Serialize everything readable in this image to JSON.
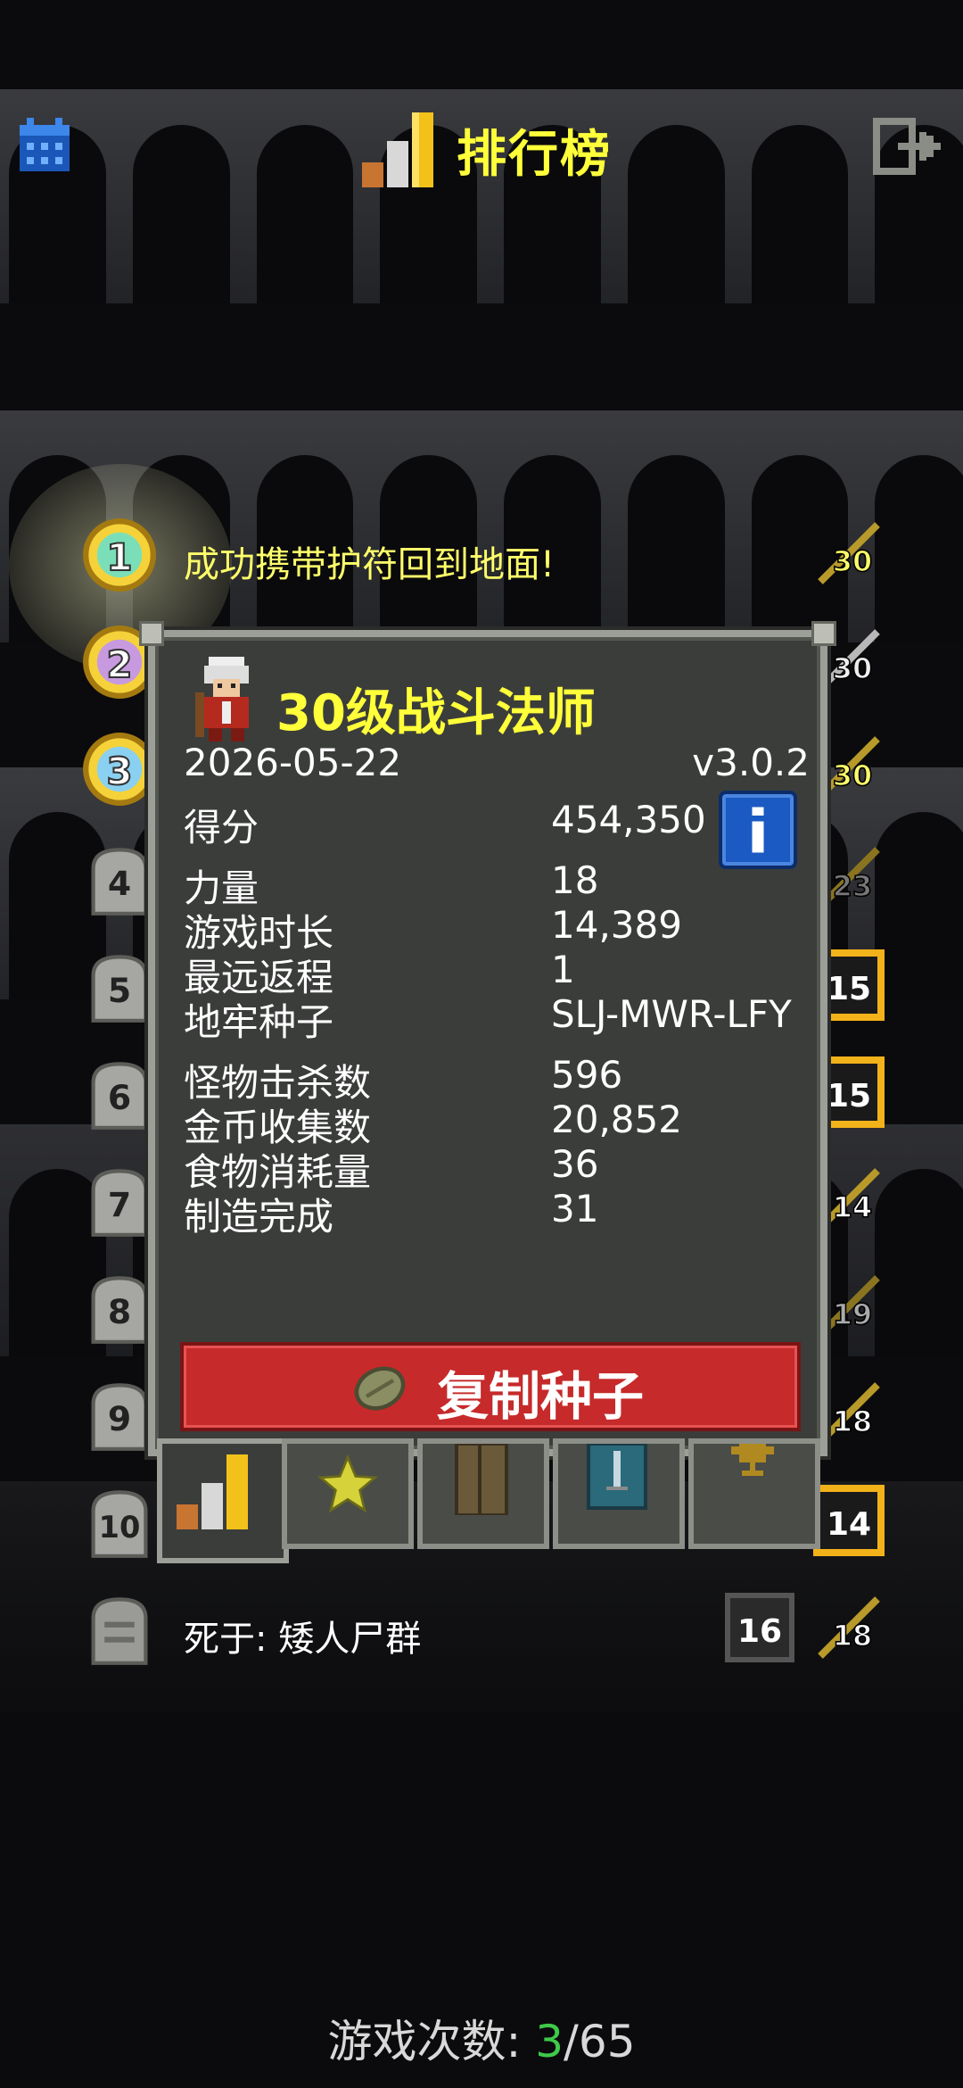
{
  "header": {
    "title": "排行榜",
    "calendar_icon": "calendar-icon",
    "exit_icon": "exit-icon",
    "title_icon": "bar-chart-icon"
  },
  "rows": [
    {
      "rank": "1",
      "text": "成功携带护符回到地面!",
      "level": "30",
      "badge": "gold-medal"
    },
    {
      "rank": "2",
      "text": "",
      "level": "30",
      "badge": "gold-medal"
    },
    {
      "rank": "3",
      "text": "",
      "level": "30",
      "badge": "gold-medal"
    },
    {
      "rank": "4",
      "text": "",
      "level": "23",
      "badge": "tombstone"
    },
    {
      "rank": "5",
      "text": "",
      "level": "15",
      "badge": "tombstone"
    },
    {
      "rank": "6",
      "text": "",
      "level": "15",
      "badge": "tombstone"
    },
    {
      "rank": "7",
      "text": "",
      "level": "14",
      "badge": "tombstone"
    },
    {
      "rank": "8",
      "text": "",
      "level": "19",
      "badge": "tombstone"
    },
    {
      "rank": "9",
      "text": "",
      "level": "18",
      "badge": "tombstone"
    },
    {
      "rank": "10",
      "text": "",
      "level": "14",
      "badge": "tombstone"
    },
    {
      "rank": "",
      "text": "死于: 矮人尸群",
      "depth": "16",
      "level": "18",
      "badge": "tombstone"
    }
  ],
  "popup": {
    "hero_title": "30级战斗法师",
    "date": "2026-05-22",
    "version": "v3.0.2",
    "score_label": "得分",
    "score_value": "454,350",
    "stats": [
      {
        "label": "力量",
        "value": "18"
      },
      {
        "label": "游戏时长",
        "value": "14,389"
      },
      {
        "label": "最远返程",
        "value": "1"
      },
      {
        "label": "地牢种子",
        "value": "SLJ-MWR-LFY"
      }
    ],
    "stats2": [
      {
        "label": "怪物击杀数",
        "value": "596"
      },
      {
        "label": "金币收集数",
        "value": "20,852"
      },
      {
        "label": "食物消耗量",
        "value": "36"
      },
      {
        "label": "制造完成",
        "value": "31"
      }
    ],
    "copy_seed_label": "复制种子"
  },
  "tabs": [
    "rankings-tab",
    "badges-tab",
    "journal-tab",
    "catalog-tab",
    "trophy-tab"
  ],
  "games": {
    "label": "游戏次数: ",
    "current": "3",
    "sep": "/",
    "total": "65"
  },
  "colors": {
    "title_yellow": "#ffff3a",
    "button_red": "#c62a2a",
    "info_blue": "#1a5ac2",
    "green": "#3fc94a"
  }
}
